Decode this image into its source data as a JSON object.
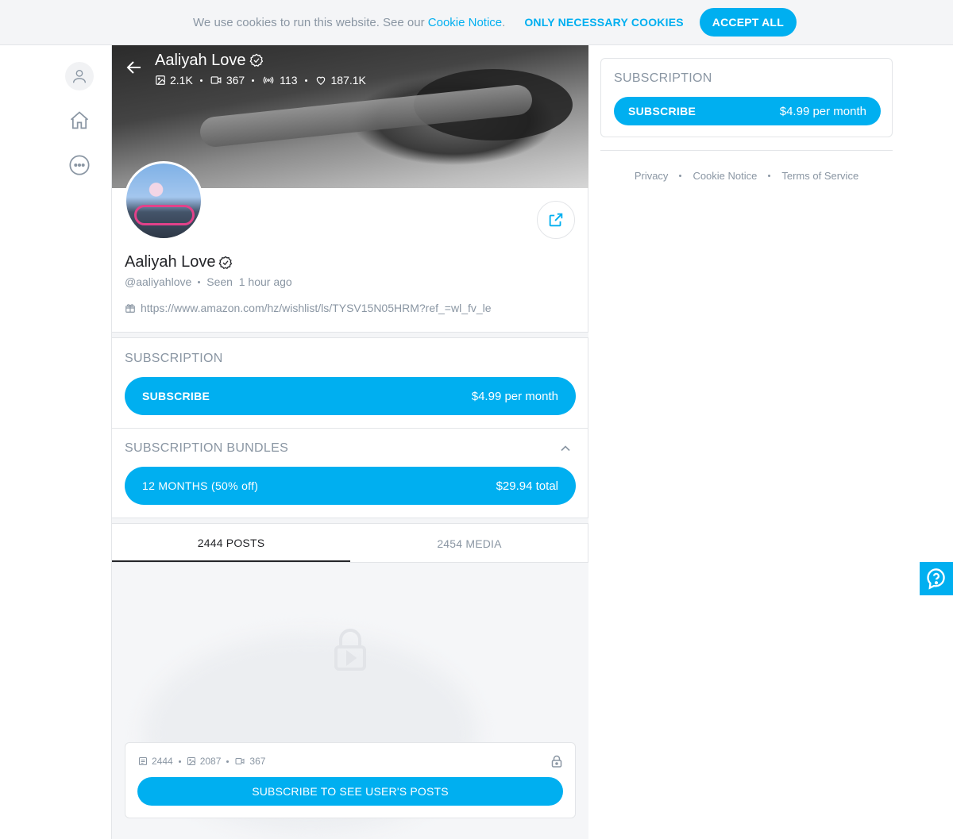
{
  "cookie": {
    "text": "We use cookies to run this website. See our",
    "link": "Cookie Notice",
    "period": ".",
    "necessary": "ONLY NECESSARY COOKIES",
    "accept": "ACCEPT ALL"
  },
  "cover": {
    "name": "Aaliyah Love",
    "stats": {
      "photos": "2.1K",
      "videos": "367",
      "streams": "113",
      "likes": "187.1K"
    }
  },
  "profile": {
    "name": "Aaliyah Love",
    "handle": "@aaliyahlove",
    "seen_label": "Seen",
    "seen_value": "1 hour ago",
    "link": "https://www.amazon.com/hz/wishlist/ls/TYSV15N05HRM?ref_=wl_fv_le"
  },
  "subscription": {
    "title": "SUBSCRIPTION",
    "button_label": "SUBSCRIBE",
    "price": "$4.99 per month"
  },
  "bundles": {
    "title": "SUBSCRIPTION BUNDLES",
    "items": [
      {
        "label": "12 MONTHS (50% off)",
        "price": "$29.94 total"
      }
    ]
  },
  "tabs": [
    {
      "label": "2444 POSTS",
      "active": true
    },
    {
      "label": "2454 MEDIA",
      "active": false
    }
  ],
  "locked": {
    "posts": "2444",
    "photos": "2087",
    "videos": "367",
    "button": "SUBSCRIBE TO SEE USER'S POSTS"
  },
  "sidebar_subscription": {
    "title": "SUBSCRIPTION",
    "button_label": "SUBSCRIBE",
    "price": "$4.99 per month"
  },
  "footer": {
    "links": [
      "Privacy",
      "Cookie Notice",
      "Terms of Service"
    ]
  },
  "colors": {
    "accent": "#00aff0",
    "muted": "#8a96a3",
    "border": "#e3e5e8"
  }
}
